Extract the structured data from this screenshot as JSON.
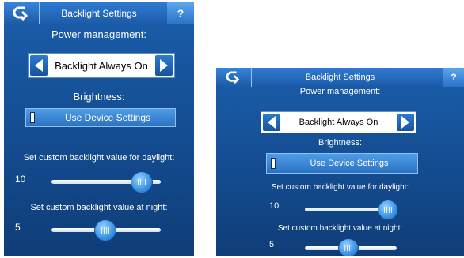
{
  "screens": [
    {
      "title": "Backlight Settings",
      "help_label": "?",
      "power_label": "Power management:",
      "power_value": "Backlight Always On",
      "brightness_label": "Brightness:",
      "device_toggle_label": "Use Device Settings",
      "daylight_label": "Set custom backlight value for daylight:",
      "daylight_value": "10",
      "daylight_level": 10,
      "night_label": "Set custom backlight value at night:",
      "night_value": "5",
      "night_level": 5
    },
    {
      "title": "Backlight Settings",
      "help_label": "?",
      "power_label": "Power management:",
      "power_value": "Backlight Always On",
      "brightness_label": "Brightness:",
      "device_toggle_label": "Use Device Settings",
      "daylight_label": "Set custom backlight value for daylight:",
      "daylight_value": "10",
      "daylight_level": 10,
      "night_label": "Set custom backlight value at night:",
      "night_value": "5",
      "night_level": 5
    }
  ],
  "icons": {
    "back": "back-arrow-icon",
    "left_arrow": "left-arrow-icon",
    "right_arrow": "right-arrow-icon",
    "help": "help-icon"
  },
  "colors": {
    "background": "#154f95",
    "titlebar": "#2f7bd2",
    "button": "#3a86d6",
    "text": "#ffffff"
  }
}
